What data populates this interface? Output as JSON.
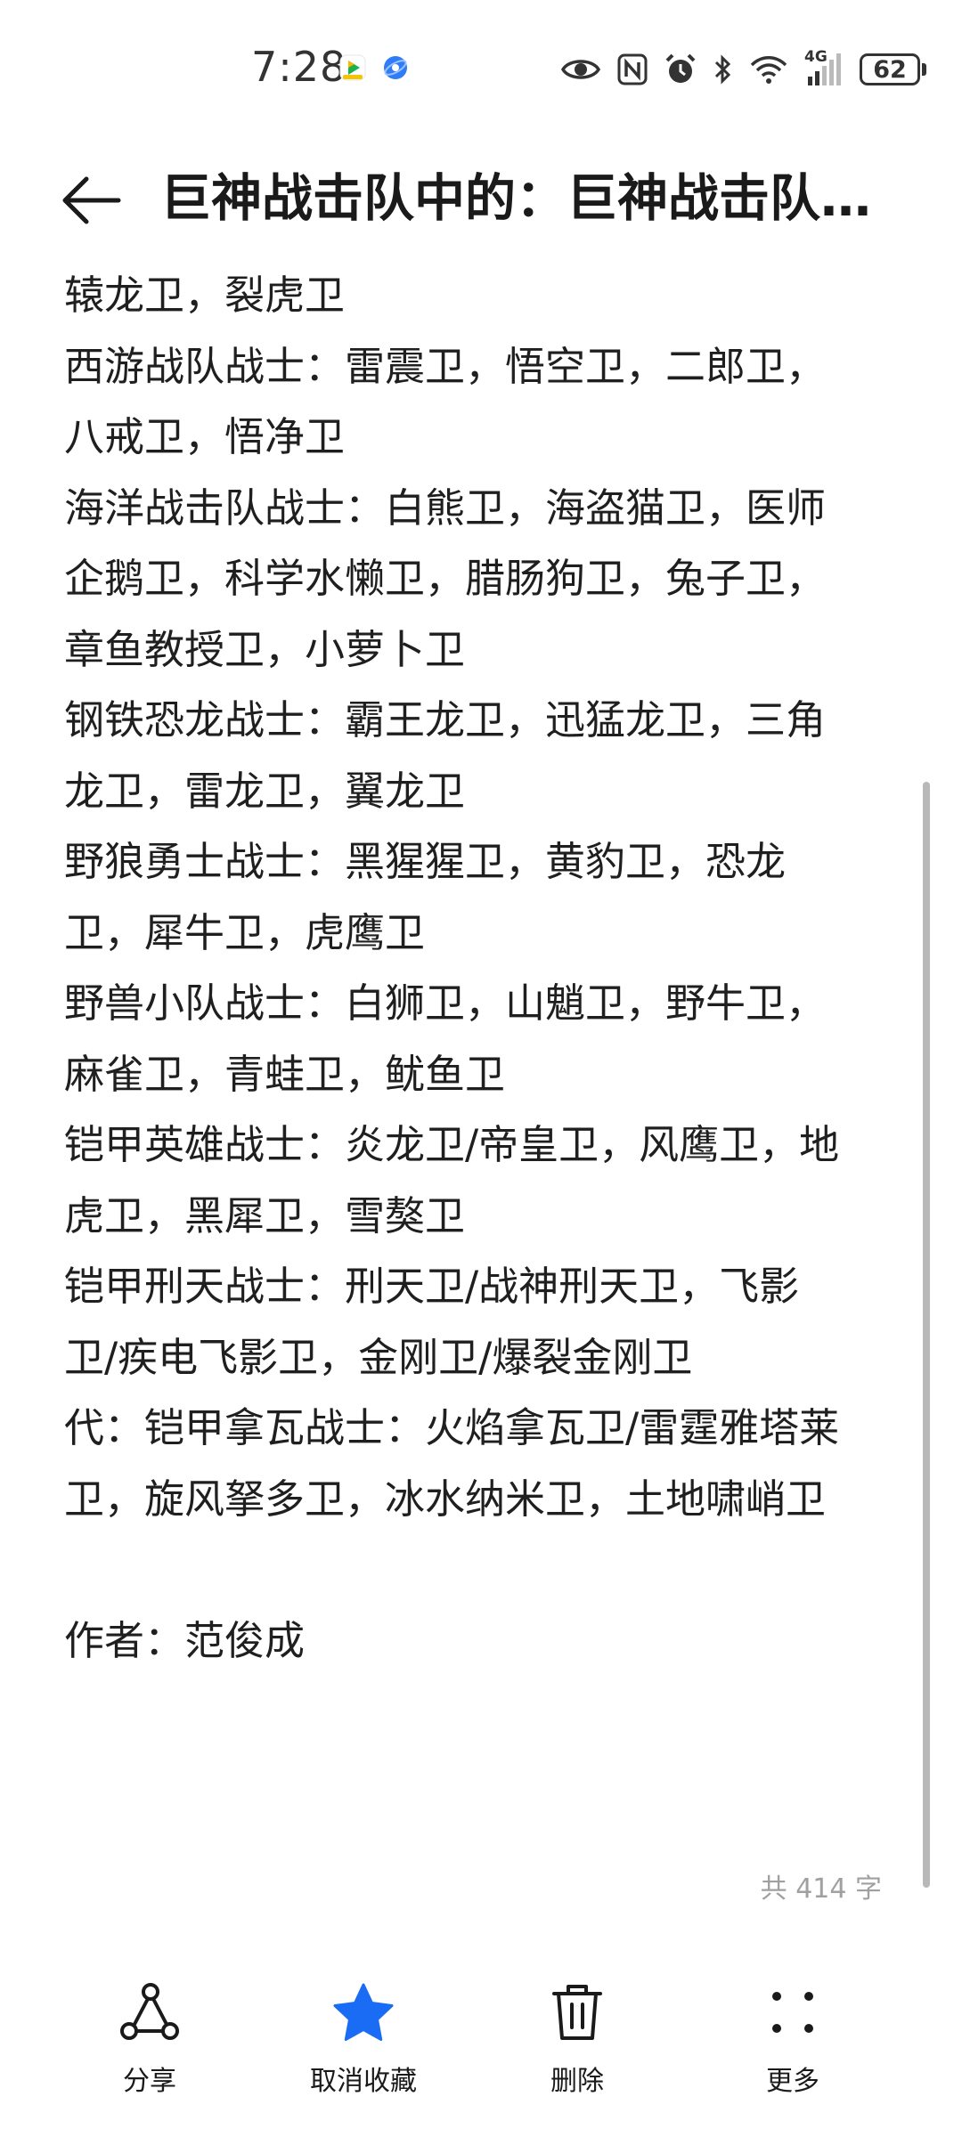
{
  "status_bar": {
    "time": "7:28",
    "network_type": "4G",
    "battery_level": "62"
  },
  "header": {
    "title": "巨神战击队中的：巨神战击队…"
  },
  "content": {
    "lines": [
      "辕龙卫，裂虎卫",
      "西游战队战士：雷震卫，悟空卫，二郎卫，",
      "八戒卫，悟净卫",
      "海洋战击队战士：白熊卫，海盗猫卫，医师",
      "企鹅卫，科学水懒卫，腊肠狗卫，兔子卫，",
      "章鱼教授卫，小萝卜卫",
      "钢铁恐龙战士：霸王龙卫，迅猛龙卫，三角",
      "龙卫，雷龙卫，翼龙卫",
      "野狼勇士战士：黑猩猩卫，黄豹卫，恐龙",
      "卫，犀牛卫，虎鹰卫",
      "野兽小队战士：白狮卫，山魈卫，野牛卫，",
      "麻雀卫，青蛙卫，鱿鱼卫",
      "铠甲英雄战士：炎龙卫/帝皇卫，风鹰卫，地",
      "虎卫，黑犀卫，雪獒卫",
      "铠甲刑天战士：刑天卫/战神刑天卫，飞影",
      "卫/疾电飞影卫，金刚卫/爆裂金刚卫",
      "代：铠甲拿瓦战士：火焰拿瓦卫/雷霆雅塔莱",
      "卫，旋风拏多卫，冰水纳米卫，土地啸峭卫",
      "",
      "作者：范俊成"
    ]
  },
  "word_count": "共 414 字",
  "toolbar": {
    "share_label": "分享",
    "unfavorite_label": "取消收藏",
    "delete_label": "删除",
    "more_label": "更多"
  },
  "colors": {
    "accent": "#1a6cf5",
    "text": "#1f1f1f",
    "muted": "#a0a0a0"
  }
}
